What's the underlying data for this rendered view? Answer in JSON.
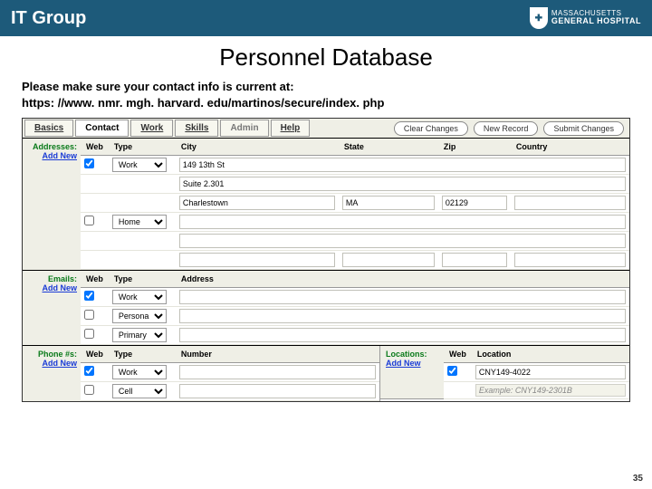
{
  "header": {
    "brand": "IT Group",
    "org_l1": "MASSACHUSETTS",
    "org_l2": "GENERAL HOSPITAL"
  },
  "title": "Personnel Database",
  "instruction_l1": "Please make sure your contact info is current at:",
  "instruction_l2": "https: //www. nmr. mgh. harvard. edu/martinos/secure/index. php",
  "tabs": [
    "Basics",
    "Contact",
    "Work",
    "Skills",
    "Admin",
    "Help"
  ],
  "actions": {
    "clear": "Clear Changes",
    "new": "New Record",
    "submit": "Submit Changes"
  },
  "addresses": {
    "label": "Addresses:",
    "add_new": "Add New",
    "cols": {
      "web": "Web",
      "type": "Type",
      "city": "City",
      "state": "State",
      "zip": "Zip",
      "country": "Country"
    },
    "rows": [
      {
        "web": true,
        "type": "Work",
        "street1": "149 13th St",
        "street2": "Suite 2.301",
        "city": "Charlestown",
        "state": "MA",
        "zip": "02129",
        "country": ""
      },
      {
        "web": false,
        "type": "Home",
        "street1": "",
        "street2": "",
        "city": "",
        "state": "",
        "zip": "",
        "country": ""
      }
    ]
  },
  "emails": {
    "label": "Emails:",
    "add_new": "Add New",
    "cols": {
      "web": "Web",
      "type": "Type",
      "address": "Address"
    },
    "rows": [
      {
        "web": true,
        "type": "Work",
        "address": ""
      },
      {
        "web": false,
        "type": "Personal",
        "address": ""
      },
      {
        "web": false,
        "type": "Primary",
        "address": ""
      }
    ]
  },
  "phones": {
    "label": "Phone #s:",
    "add_new": "Add New",
    "cols": {
      "web": "Web",
      "type": "Type",
      "number": "Number"
    },
    "rows": [
      {
        "web": true,
        "type": "Work",
        "number": ""
      },
      {
        "web": false,
        "type": "Cell",
        "number": ""
      }
    ]
  },
  "locations": {
    "label": "Locations:",
    "add_new": "Add New",
    "cols": {
      "web": "Web",
      "location": "Location"
    },
    "rows": [
      {
        "web": true,
        "location": "CNY149-4022"
      }
    ],
    "example": "Example: CNY149-2301B"
  },
  "page": "35"
}
